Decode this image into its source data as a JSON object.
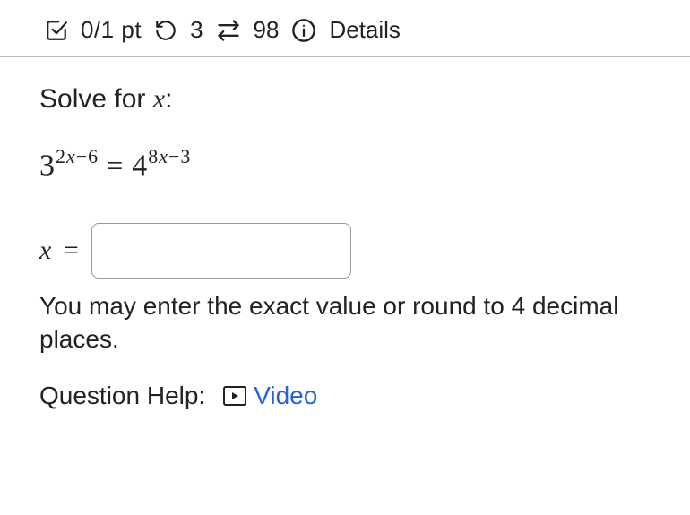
{
  "header": {
    "score": "0/1 pt",
    "attempts_remaining": "3",
    "retries": "98",
    "details_label": "Details"
  },
  "question": {
    "prompt_prefix": "Solve for ",
    "prompt_var": "x",
    "prompt_suffix": ":",
    "equation": {
      "left_base": "3",
      "left_exp_coef": "2",
      "left_exp_var": "x",
      "left_exp_const": "−6",
      "equals": " = ",
      "right_base": "4",
      "right_exp_coef": "8",
      "right_exp_var": "x",
      "right_exp_const": "−3"
    },
    "answer_var": "x",
    "answer_eq": " =",
    "answer_value": "",
    "hint": "You may enter the exact value or round to 4 decimal places."
  },
  "help": {
    "label": "Question Help:",
    "video_label": "Video"
  }
}
